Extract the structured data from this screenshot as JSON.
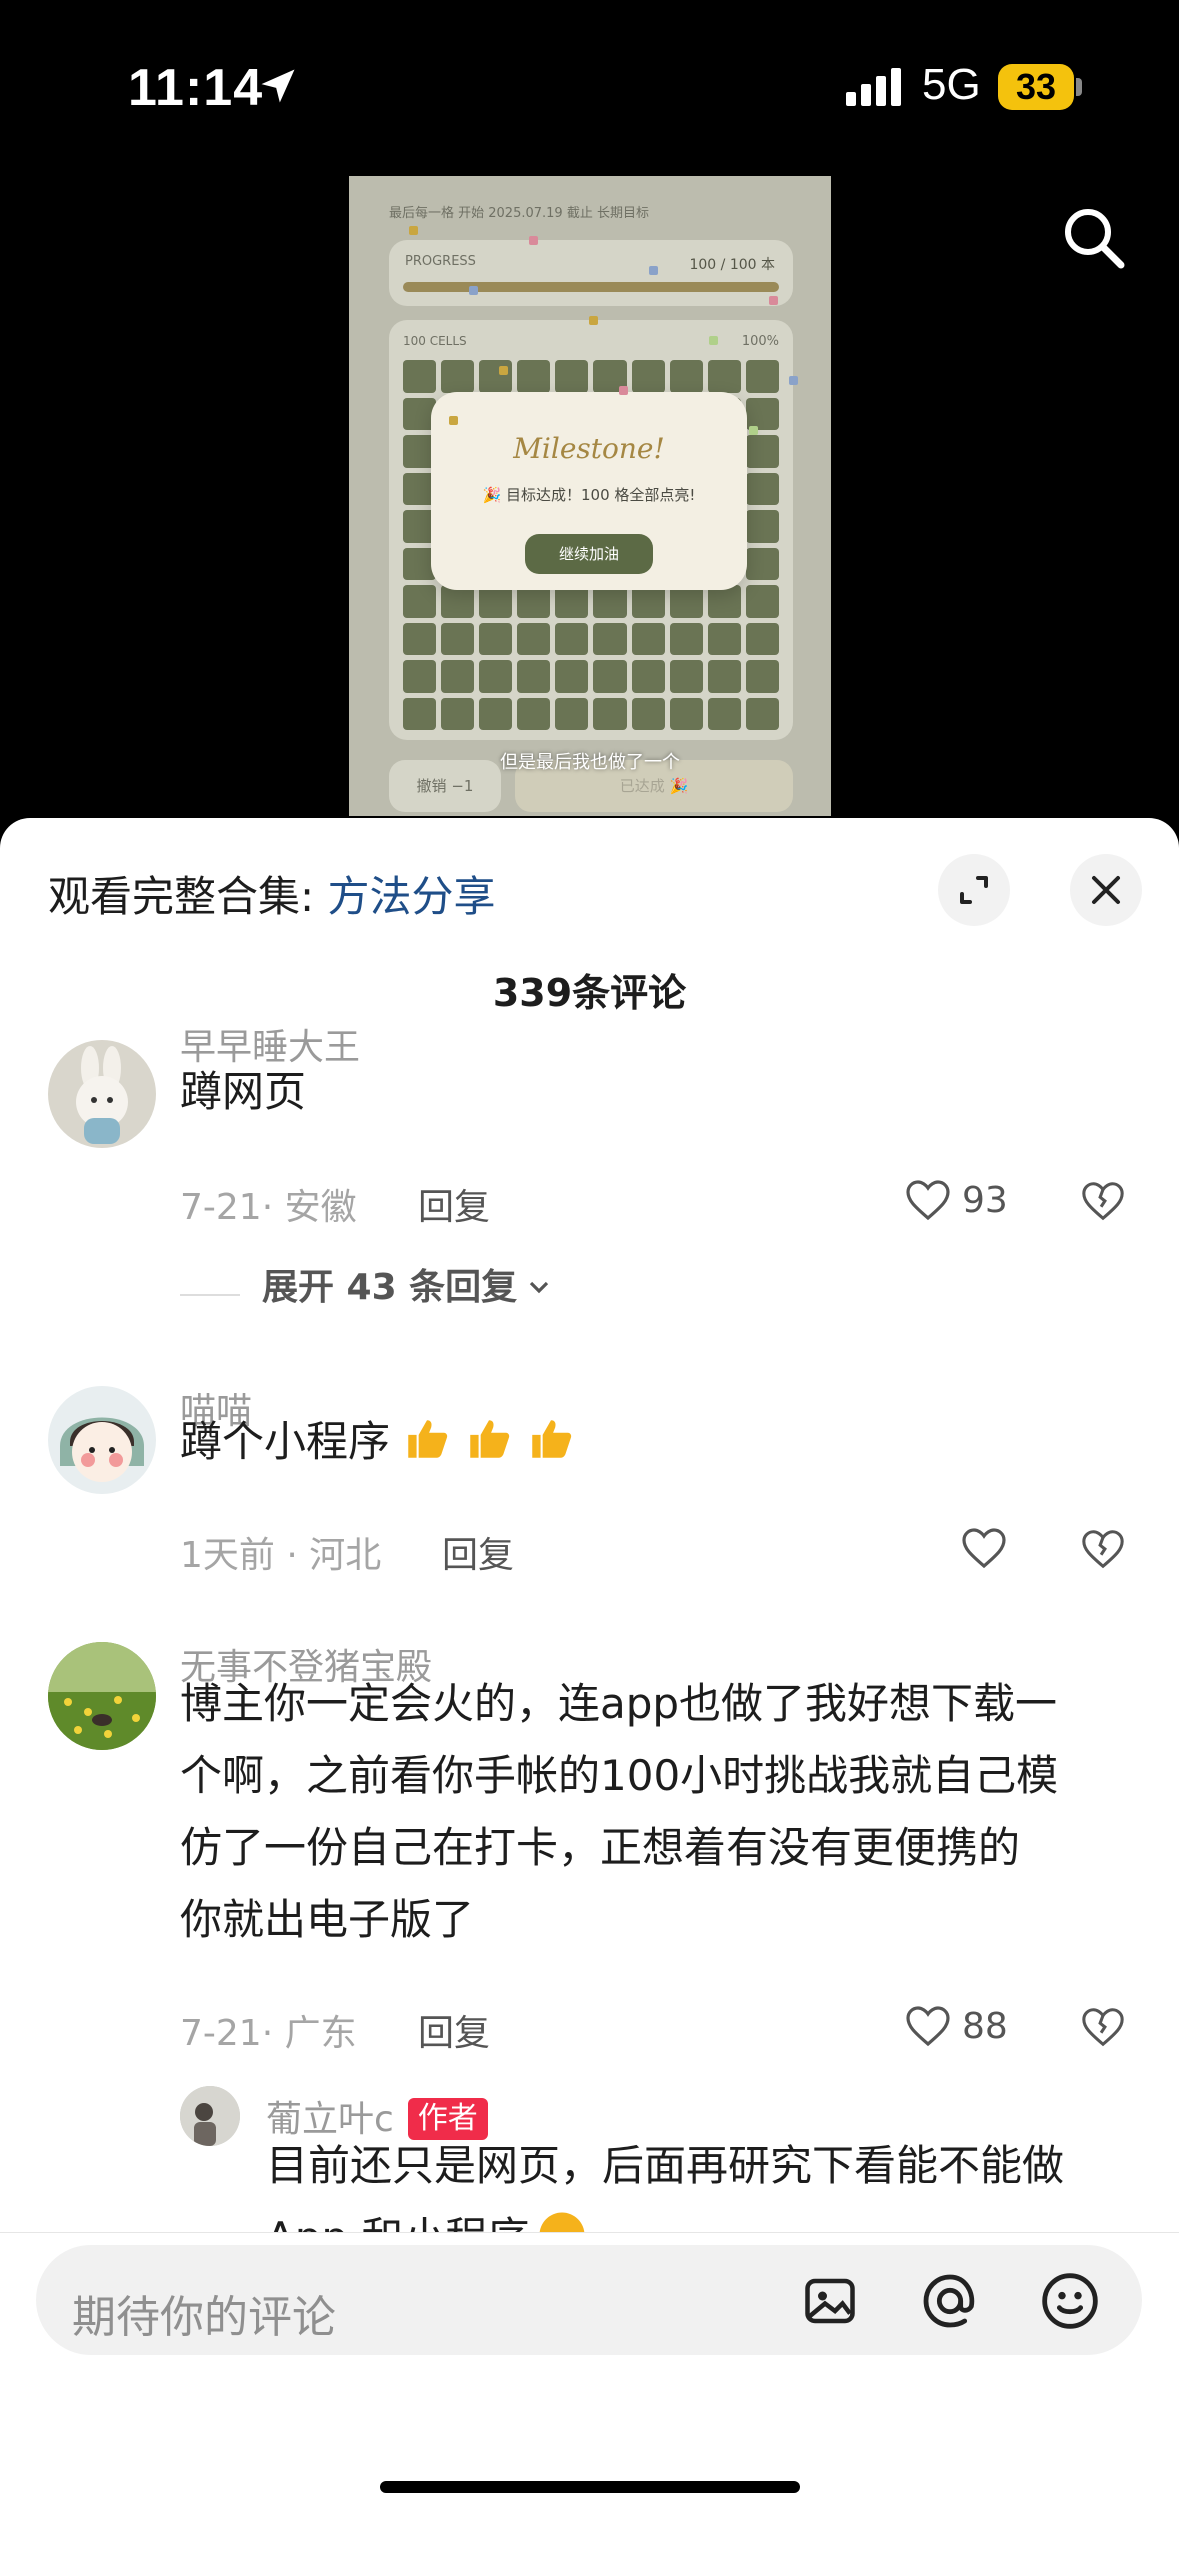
{
  "status_bar": {
    "time": "11:14",
    "network": "5G",
    "battery": "33"
  },
  "video": {
    "header": "最后每一格 开始 2025.07.19  截止 长期目标",
    "progress_label": "PROGRESS",
    "progress_value": "100 / 100 本",
    "progress_fraction": 1.0,
    "cells_label": "100 CELLS",
    "cells_percent": "100%",
    "modal_title": "Milestone!",
    "modal_text": "🎉 目标达成！100 格全部点亮!",
    "modal_button": "继续加油",
    "undo_button": "撤销 −1",
    "done_button": "已达成 🎉",
    "subtitle": "但是最后我也做了一个"
  },
  "sheet": {
    "collection_prefix": "观看完整合集: ",
    "collection_link": "方法分享",
    "comment_count": "339条评论"
  },
  "comments": [
    {
      "username": "早早睡大王",
      "text": "蹲网页",
      "meta": "7-21· 安徽",
      "reply": "回复",
      "likes": "93",
      "expand": "展开 43 条回复"
    },
    {
      "username": "喵喵",
      "text": "蹲个小程序",
      "meta": "1天前 · 河北",
      "reply": "回复",
      "likes": ""
    },
    {
      "username": "无事不登猪宝殿",
      "lines": [
        "博主你一定会火的，连app也做了我好想下载一",
        "个啊，之前看你手帐的100小时挑战我就自己模",
        "仿了一份自己在打卡，正想着有没有更便携的",
        "你就出电子版了"
      ],
      "meta": "7-21· 广东",
      "reply": "回复",
      "likes": "88"
    }
  ],
  "author_reply": {
    "username": "葡立叶c",
    "badge": "作者",
    "lines": [
      "目前还只是网页，后面再研究下看能不能做",
      "App 和小程序"
    ]
  },
  "input": {
    "placeholder": "期待你的评论"
  },
  "colors": {
    "accent_link": "#1f4e88",
    "badge": "#f02c4a",
    "video_bg": "#bcbcae",
    "cell": "#6a7454"
  },
  "icons": [
    "location-arrow-icon",
    "signal-icon",
    "search-icon",
    "expand-icon",
    "close-icon",
    "heart-icon",
    "broken-heart-icon",
    "image-icon",
    "at-icon",
    "emoji-icon",
    "thumbs-up-icon",
    "hug-emoji-icon"
  ]
}
